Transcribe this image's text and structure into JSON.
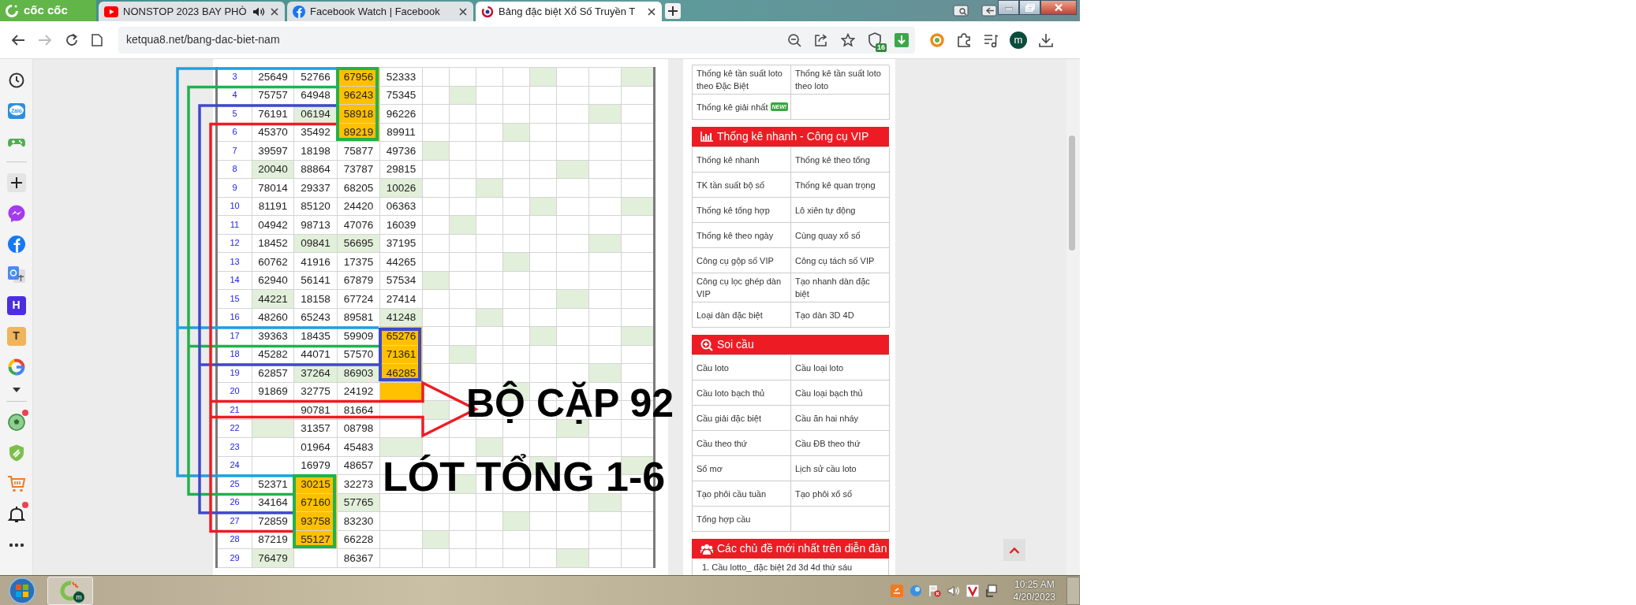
{
  "browser": {
    "brand": "cốc cốc",
    "tabs": [
      {
        "kind": "video",
        "title": "NONSTOP 2023 BAY PHÒ",
        "audio": true,
        "selected": false
      },
      {
        "kind": "facebook",
        "title": "Facebook Watch | Facebook",
        "audio": false,
        "selected": false
      },
      {
        "kind": "site",
        "title": "Bảng đặc biệt Xổ Số Truyền T",
        "audio": false,
        "selected": true
      }
    ],
    "url": "ketqua8.net/bang-dac-biet-nam",
    "shield_count": "16",
    "profile_initial": "m"
  },
  "side_apps": [
    {
      "kind": "history",
      "alert": false
    },
    {
      "kind": "zalo",
      "label": "Zalo",
      "alert": false
    },
    {
      "kind": "game",
      "alert": false
    },
    {
      "kind": "divider"
    },
    {
      "kind": "add",
      "alert": false
    },
    {
      "kind": "messenger",
      "alert": false
    },
    {
      "kind": "facebook",
      "alert": false
    },
    {
      "kind": "translate",
      "alert": false
    },
    {
      "kind": "letter",
      "label": "H",
      "color": "#4b2ee0",
      "alert": false
    },
    {
      "kind": "letter",
      "label": "T",
      "color": "#f0b45a",
      "alert": false
    },
    {
      "kind": "google",
      "alert": false
    },
    {
      "kind": "collapse",
      "alert": false
    },
    {
      "kind": "divider"
    },
    {
      "kind": "soccer",
      "alert": true
    },
    {
      "kind": "shield",
      "alert": false
    },
    {
      "kind": "cart",
      "alert": false
    },
    {
      "kind": "bell",
      "alert": true
    },
    {
      "kind": "more",
      "alert": false
    }
  ],
  "table": {
    "rows": [
      {
        "num": "3",
        "cells": [
          {
            "value": "25649"
          },
          {
            "value": "52766"
          },
          {
            "value": "67956",
            "color": "#ffc000"
          },
          {
            "value": "52333"
          }
        ],
        "hits": [
          false,
          false,
          false,
          false,
          true,
          false,
          false,
          true
        ]
      },
      {
        "num": "4",
        "cells": [
          {
            "value": "75757"
          },
          {
            "value": "64948"
          },
          {
            "value": "96243",
            "color": "#ffc000"
          },
          {
            "value": "75345"
          }
        ],
        "hits": [
          false,
          true,
          false,
          false,
          false,
          false,
          false,
          false
        ]
      },
      {
        "num": "5",
        "cells": [
          {
            "value": "76191"
          },
          {
            "value": "06194",
            "color": "#e2efda"
          },
          {
            "value": "58918",
            "color": "#ffc000"
          },
          {
            "value": "96226"
          }
        ],
        "hits": [
          false,
          false,
          false,
          false,
          false,
          false,
          true,
          false
        ]
      },
      {
        "num": "6",
        "cells": [
          {
            "value": "45370"
          },
          {
            "value": "35492"
          },
          {
            "value": "89219",
            "color": "#ffc000"
          },
          {
            "value": "89911"
          }
        ],
        "hits": [
          false,
          false,
          false,
          true,
          false,
          false,
          false,
          false
        ]
      },
      {
        "num": "7",
        "cells": [
          {
            "value": "39597"
          },
          {
            "value": "18198"
          },
          {
            "value": "75877"
          },
          {
            "value": "49736"
          }
        ],
        "hits": [
          true,
          false,
          false,
          false,
          false,
          false,
          false,
          false
        ]
      },
      {
        "num": "8",
        "cells": [
          {
            "value": "20040",
            "color": "#e2efda"
          },
          {
            "value": "88864"
          },
          {
            "value": "73787"
          },
          {
            "value": "29815"
          }
        ],
        "hits": [
          false,
          false,
          false,
          false,
          false,
          true,
          false,
          false
        ]
      },
      {
        "num": "9",
        "cells": [
          {
            "value": "78014"
          },
          {
            "value": "29337"
          },
          {
            "value": "68205"
          },
          {
            "value": "10026",
            "color": "#e2efda"
          }
        ],
        "hits": [
          false,
          false,
          true,
          false,
          false,
          false,
          false,
          false
        ]
      },
      {
        "num": "10",
        "cells": [
          {
            "value": "81191"
          },
          {
            "value": "85120"
          },
          {
            "value": "24420"
          },
          {
            "value": "06363"
          }
        ],
        "hits": [
          false,
          false,
          false,
          false,
          true,
          false,
          false,
          true
        ]
      },
      {
        "num": "11",
        "cells": [
          {
            "value": "04942"
          },
          {
            "value": "98713"
          },
          {
            "value": "47076"
          },
          {
            "value": "16039"
          }
        ],
        "hits": [
          false,
          true,
          false,
          false,
          false,
          false,
          false,
          false
        ]
      },
      {
        "num": "12",
        "cells": [
          {
            "value": "18452"
          },
          {
            "value": "09841",
            "color": "#e2efda"
          },
          {
            "value": "56695",
            "color": "#e2efda"
          },
          {
            "value": "37195"
          }
        ],
        "hits": [
          false,
          false,
          false,
          false,
          false,
          false,
          true,
          false
        ]
      },
      {
        "num": "13",
        "cells": [
          {
            "value": "60762"
          },
          {
            "value": "41916"
          },
          {
            "value": "17375"
          },
          {
            "value": "44265"
          }
        ],
        "hits": [
          false,
          false,
          false,
          true,
          false,
          false,
          false,
          false
        ]
      },
      {
        "num": "14",
        "cells": [
          {
            "value": "62940"
          },
          {
            "value": "56141"
          },
          {
            "value": "67879"
          },
          {
            "value": "57534"
          }
        ],
        "hits": [
          true,
          false,
          false,
          false,
          false,
          false,
          false,
          false
        ]
      },
      {
        "num": "15",
        "cells": [
          {
            "value": "44221",
            "color": "#e2efda"
          },
          {
            "value": "18158"
          },
          {
            "value": "67724"
          },
          {
            "value": "27414"
          }
        ],
        "hits": [
          false,
          false,
          false,
          false,
          false,
          true,
          false,
          false
        ]
      },
      {
        "num": "16",
        "cells": [
          {
            "value": "48260"
          },
          {
            "value": "65243"
          },
          {
            "value": "89581"
          },
          {
            "value": "41248",
            "color": "#e2efda"
          }
        ],
        "hits": [
          false,
          false,
          true,
          false,
          false,
          false,
          false,
          false
        ]
      },
      {
        "num": "17",
        "cells": [
          {
            "value": "39363"
          },
          {
            "value": "18435"
          },
          {
            "value": "59909"
          },
          {
            "value": "65276",
            "color": "#ffc000"
          }
        ],
        "hits": [
          false,
          false,
          false,
          false,
          true,
          false,
          false,
          true
        ]
      },
      {
        "num": "18",
        "cells": [
          {
            "value": "45282"
          },
          {
            "value": "44071"
          },
          {
            "value": "57570"
          },
          {
            "value": "71361",
            "color": "#ffc000"
          }
        ],
        "hits": [
          false,
          true,
          false,
          false,
          false,
          false,
          false,
          false
        ]
      },
      {
        "num": "19",
        "cells": [
          {
            "value": "62857"
          },
          {
            "value": "37264",
            "color": "#e2efda"
          },
          {
            "value": "86903",
            "color": "#e2efda"
          },
          {
            "value": "46285",
            "color": "#ffc000"
          }
        ],
        "hits": [
          false,
          false,
          false,
          false,
          false,
          false,
          true,
          false
        ]
      },
      {
        "num": "20",
        "cells": [
          {
            "value": "91869"
          },
          {
            "value": "32775"
          },
          {
            "value": "24192"
          },
          {
            "color": "#ffc000"
          }
        ],
        "hits": [
          false,
          false,
          false,
          true,
          false,
          false,
          false,
          false
        ]
      },
      {
        "num": "21",
        "cells": [
          {},
          {
            "value": "90781"
          },
          {
            "value": "81664"
          },
          {}
        ],
        "hits": [
          true,
          false,
          false,
          false,
          false,
          false,
          false,
          false
        ]
      },
      {
        "num": "22",
        "cells": [
          {
            "color": "#e2efda"
          },
          {
            "value": "31357"
          },
          {
            "value": "08798"
          },
          {}
        ],
        "hits": [
          false,
          false,
          false,
          false,
          false,
          true,
          false,
          false
        ]
      },
      {
        "num": "23",
        "cells": [
          {},
          {
            "value": "01964"
          },
          {
            "value": "45483"
          },
          {
            "color": "#e2efda"
          }
        ],
        "hits": [
          false,
          false,
          true,
          false,
          false,
          false,
          false,
          false
        ]
      },
      {
        "num": "24",
        "cells": [
          {},
          {
            "value": "16979"
          },
          {
            "value": "48657"
          },
          {}
        ],
        "hits": [
          false,
          false,
          false,
          false,
          true,
          false,
          false,
          true
        ]
      },
      {
        "num": "25",
        "cells": [
          {
            "value": "52371"
          },
          {
            "value": "30215",
            "color": "#ffc000"
          },
          {
            "value": "32273"
          },
          {}
        ],
        "hits": [
          false,
          true,
          false,
          false,
          false,
          false,
          false,
          false
        ]
      },
      {
        "num": "26",
        "cells": [
          {
            "value": "34164"
          },
          {
            "value": "67160",
            "color": "#ffc000"
          },
          {
            "value": "57765",
            "color": "#e2efda"
          },
          {}
        ],
        "hits": [
          false,
          false,
          false,
          false,
          false,
          false,
          true,
          false
        ]
      },
      {
        "num": "27",
        "cells": [
          {
            "value": "72859"
          },
          {
            "value": "93758",
            "color": "#ffc000"
          },
          {
            "value": "83230"
          },
          {}
        ],
        "hits": [
          false,
          false,
          false,
          true,
          false,
          false,
          false,
          false
        ]
      },
      {
        "num": "28",
        "cells": [
          {
            "value": "87219"
          },
          {
            "value": "55127",
            "color": "#ffc000"
          },
          {
            "value": "66228"
          },
          {}
        ],
        "hits": [
          true,
          false,
          false,
          false,
          false,
          false,
          false,
          false
        ]
      },
      {
        "num": "29",
        "cells": [
          {
            "value": "76479",
            "color": "#e2efda"
          },
          {},
          {
            "value": "86367"
          },
          {}
        ],
        "hits": [
          false,
          false,
          false,
          false,
          false,
          true,
          false,
          false
        ]
      }
    ]
  },
  "overlay": {
    "headline": "BỘ CẶP 92",
    "subline": "LÓT TỔNG 1-6"
  },
  "sidebar": [
    {
      "links": [
        {
          "label": "Thống kê tần suất loto theo Đặc Biệt"
        },
        {
          "label": "Thống kê tần suất loto theo loto"
        },
        {
          "label": "Thống kê giải nhất",
          "badge": "NEW!"
        }
      ]
    },
    {
      "title": "Thống kê nhanh - Công cụ VIP",
      "links": [
        {
          "label": "Thống kê nhanh"
        },
        {
          "label": "Thống kê theo tổng"
        },
        {
          "label": "TK tần suất bộ số"
        },
        {
          "label": "Thống kê quan trọng"
        },
        {
          "label": "Thống kê tổng hợp"
        },
        {
          "label": "Lô xiên tự động"
        },
        {
          "label": "Thống kê theo ngày"
        },
        {
          "label": "Cùng quay xổ số"
        },
        {
          "label": "Công cụ gộp số VIP"
        },
        {
          "label": "Công cụ tách số VIP"
        },
        {
          "label": "Công cụ lọc ghép dàn VIP"
        },
        {
          "label": "Tạo nhanh dàn đặc biệt"
        },
        {
          "label": "Loại dàn đặc biệt"
        },
        {
          "label": "Tạo dàn 3D 4D"
        }
      ]
    },
    {
      "title": "Soi cầu",
      "links": [
        {
          "label": "Cầu loto"
        },
        {
          "label": "Cầu loại loto"
        },
        {
          "label": "Cầu loto bạch thủ"
        },
        {
          "label": "Cầu loại bạch thủ"
        },
        {
          "label": "Cầu giải đặc biệt"
        },
        {
          "label": "Cầu ăn hai nháy"
        },
        {
          "label": "Cầu theo thứ"
        },
        {
          "label": "Cầu ĐB theo thứ"
        },
        {
          "label": "Sổ mơ"
        },
        {
          "label": "Lịch sử cầu loto"
        },
        {
          "label": "Tạo phôi cầu tuần"
        },
        {
          "label": "Tạo phôi xổ số"
        },
        {
          "label": "Tổng hợp cầu"
        }
      ]
    },
    {
      "title": "Các chủ đề mới nhất trên diễn đàn",
      "topics": [
        {
          "index": "1.",
          "title": "Cầu lotto_ đặc biệt 2d 3d 4d thứ sáu"
        }
      ]
    }
  ],
  "taskbar": {
    "app_badge": "m",
    "time": "10:25 AM",
    "date": "4/20/2023"
  }
}
